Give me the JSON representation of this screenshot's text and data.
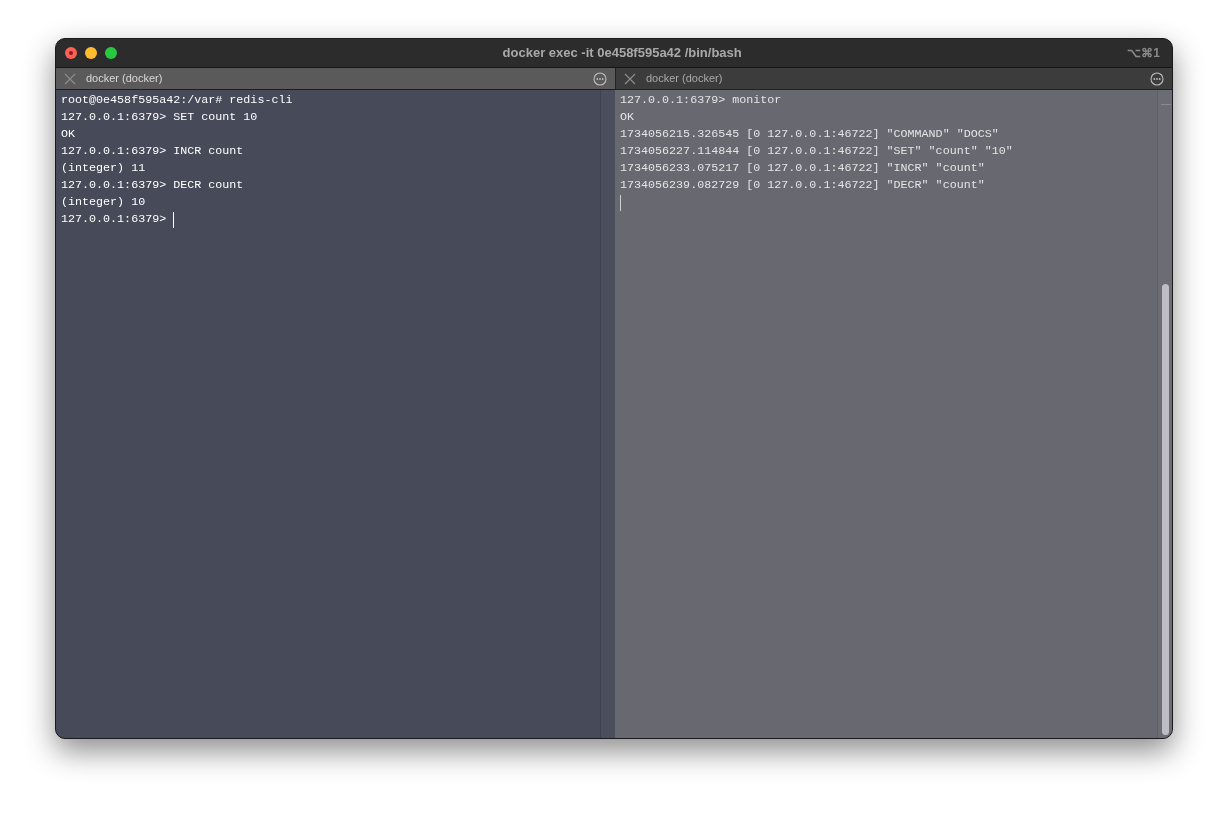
{
  "window": {
    "title": "docker exec -it 0e458f595a42 /bin/bash",
    "shortcut": "⌥⌘1"
  },
  "panes": [
    {
      "tab_label": "docker (docker)",
      "active": true,
      "lines": [
        "root@0e458f595a42:/var# redis-cli",
        "127.0.0.1:6379> SET count 10",
        "OK",
        "127.0.0.1:6379> INCR count",
        "(integer) 11",
        "127.0.0.1:6379> DECR count",
        "(integer) 10",
        "127.0.0.1:6379> "
      ],
      "cursor_on_new_line": false
    },
    {
      "tab_label": "docker (docker)",
      "active": false,
      "lines": [
        "127.0.0.1:6379> monitor",
        "OK",
        "1734056215.326545 [0 127.0.0.1:46722] \"COMMAND\" \"DOCS\"",
        "1734056227.114844 [0 127.0.0.1:46722] \"SET\" \"count\" \"10\"",
        "1734056233.075217 [0 127.0.0.1:46722] \"INCR\" \"count\"",
        "1734056239.082729 [0 127.0.0.1:46722] \"DECR\" \"count\""
      ],
      "cursor_on_new_line": true
    }
  ]
}
